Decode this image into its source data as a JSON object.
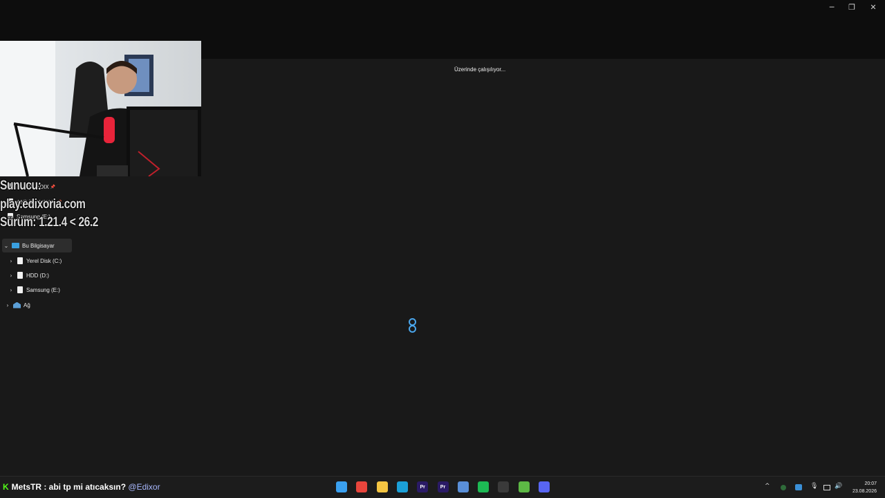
{
  "window": {
    "minimize": "─",
    "maximize": "❐",
    "close": "✕"
  },
  "content": {
    "status_text": "Üzerinde çalışılıyor..."
  },
  "overlay": {
    "line1": "Sunucu:",
    "line2": "play.edixoria.com",
    "line3": "Sürüm: 1.21.4 < 26.2"
  },
  "sidebar": {
    "pinned": [
      {
        "label": "MUSIC EDIX",
        "pin": "📌"
      },
      {
        "label": "ANİLİK ALINAN",
        "pin": "📌"
      },
      {
        "label": "Samsung (E:)",
        "pin": ""
      }
    ],
    "this_pc": {
      "label": "Bu Bilgisayar",
      "chevron": "⌄"
    },
    "drives": [
      {
        "label": "Yerel Disk (C:)",
        "chevron": "›"
      },
      {
        "label": "HDD (D:)",
        "chevron": "›"
      },
      {
        "label": "Samsung (E:)",
        "chevron": "›"
      }
    ],
    "network": {
      "label": "Ağ",
      "chevron": "›"
    }
  },
  "taskbar": {
    "chat_prefix": "K",
    "chat_user": "MetsTR",
    "chat_message": " : abi tp mi atıcaksın? ",
    "chat_mention": "@Edixor",
    "apps": [
      {
        "name": "start-icon",
        "label": "",
        "color": "#3aa0f0"
      },
      {
        "name": "chrome-icon",
        "label": "",
        "color": "#e8453c"
      },
      {
        "name": "file-explorer-icon",
        "label": "",
        "color": "#f4c542"
      },
      {
        "name": "edge-icon",
        "label": "",
        "color": "#1ba0d8"
      },
      {
        "name": "premiere-icon",
        "label": "Pr",
        "color": "#2a1a66"
      },
      {
        "name": "premiere-icon-2",
        "label": "Pr",
        "color": "#2a1a66"
      },
      {
        "name": "settings-app-icon",
        "label": "",
        "color": "#5a8fd8"
      },
      {
        "name": "spotify-icon",
        "label": "",
        "color": "#1db954"
      },
      {
        "name": "steam-icon",
        "label": "",
        "color": "#3a3a3a"
      },
      {
        "name": "minecraft-icon",
        "label": "",
        "color": "#5db845"
      },
      {
        "name": "discord-icon",
        "label": "",
        "color": "#5865f2"
      }
    ],
    "tray_chevron": "^",
    "time": "20:07",
    "date": "23.08.2026"
  }
}
